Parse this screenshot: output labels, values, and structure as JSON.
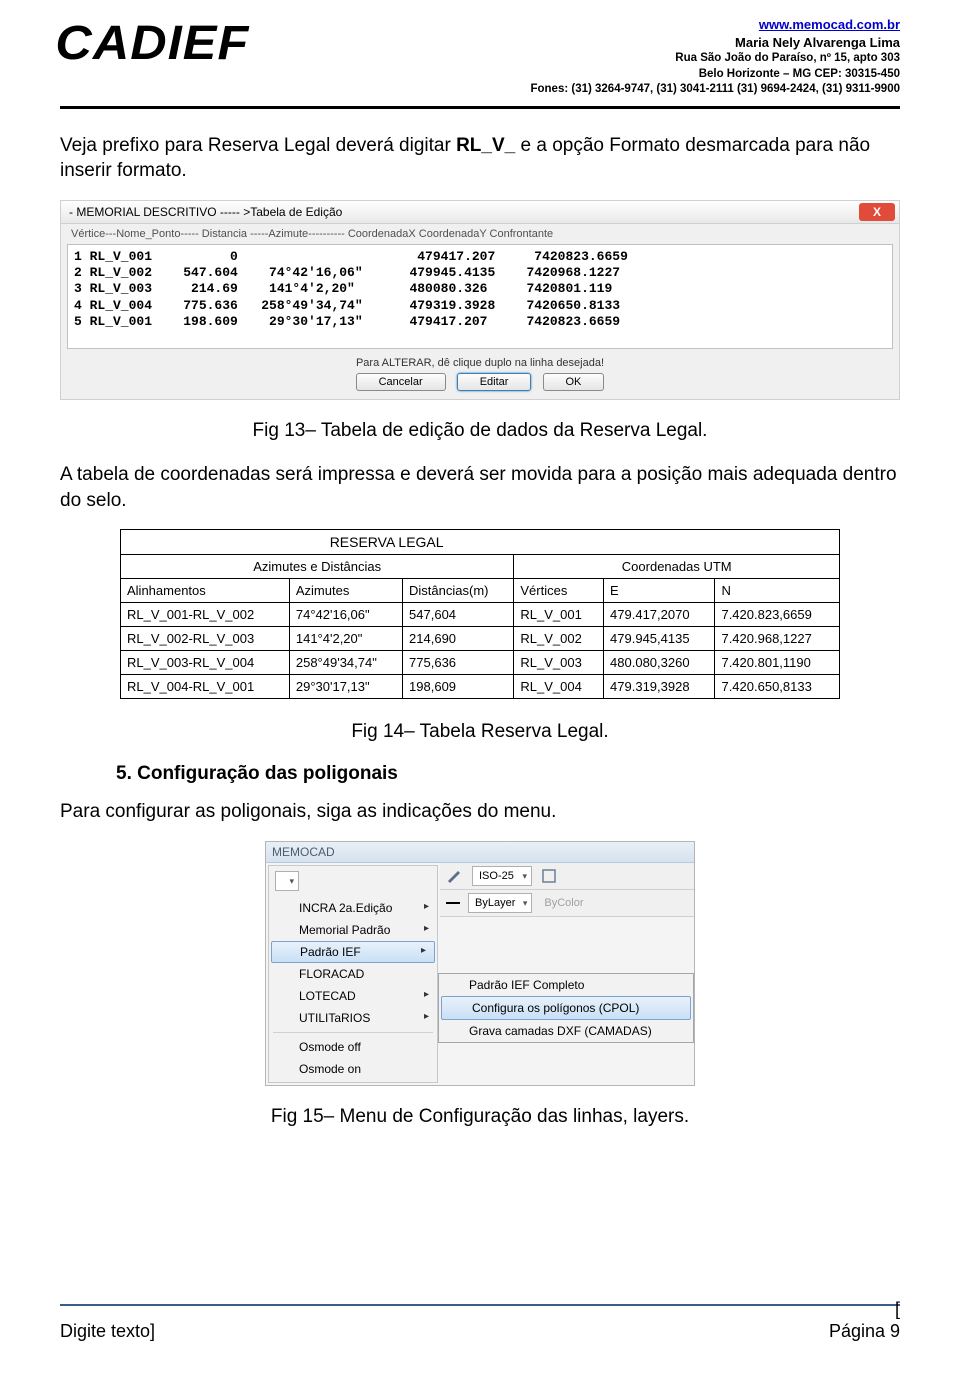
{
  "header": {
    "logo": "CADIEF",
    "url": "www.memocad.com.br",
    "name": "Maria Nely Alvarenga Lima",
    "addr1": "Rua São João do Paraíso, nº 15, apto 303",
    "addr2": "Belo Horizonte – MG CEP: 30315-450",
    "phones": "Fones: (31) 3264-9747, (31) 3041-2111  (31) 9694-2424, (31) 9311-9900"
  },
  "para1_a": "Veja prefixo para Reserva Legal deverá digitar  ",
  "para1_b": "RL_V_",
  "para1_c": "  e a opção Formato desmarcada para não inserir formato.",
  "dialog": {
    "title": "- MEMORIAL DESCRITIVO ----- >Tabela de Edição",
    "close": "X",
    "cols": "Vértice---Nome_Ponto-----  Distancia  -----Azimute----------              CoordenadaX  CoordenadaY   Confrontante",
    "rows": [
      "1 RL_V_001          0                       479417.207     7420823.6659",
      "2 RL_V_002    547.604    74°42'16,06\"      479945.4135    7420968.1227",
      "3 RL_V_003     214.69    141°4'2,20\"       480080.326     7420801.119",
      "4 RL_V_004    775.636   258°49'34,74\"      479319.3928    7420650.8133",
      "5 RL_V_001    198.609    29°30'17,13\"      479417.207     7420823.6659"
    ],
    "hint": "Para ALTERAR, dê clique duplo na linha desejada!",
    "btn_cancel": "Cancelar",
    "btn_edit": "Editar",
    "btn_ok": "OK"
  },
  "fig13": "Fig 13– Tabela de edição de dados da Reserva Legal.",
  "para2": "A tabela de coordenadas será impressa e deverá ser movida para a posição mais adequada dentro do selo.",
  "rl": {
    "title": "RESERVA LEGAL",
    "h1": "Azimutes e Distâncias",
    "h2": "Coordenadas UTM",
    "cols": [
      "Alinhamentos",
      "Azimutes",
      "Distâncias(m)",
      "Vértices",
      "E",
      "N"
    ],
    "rows": [
      [
        "RL_V_001-RL_V_002",
        "74°42'16,06\"",
        "547,604",
        "RL_V_001",
        "479.417,2070",
        "7.420.823,6659"
      ],
      [
        "RL_V_002-RL_V_003",
        "141°4'2,20\"",
        "214,690",
        "RL_V_002",
        "479.945,4135",
        "7.420.968,1227"
      ],
      [
        "RL_V_003-RL_V_004",
        "258°49'34,74\"",
        "775,636",
        "RL_V_003",
        "480.080,3260",
        "7.420.801,1190"
      ],
      [
        "RL_V_004-RL_V_001",
        "29°30'17,13\"",
        "198,609",
        "RL_V_004",
        "479.319,3928",
        "7.420.650,8133"
      ]
    ]
  },
  "fig14": "Fig 14– Tabela Reserva Legal.",
  "heading5": "5.  Configuração das poligonais",
  "para3": "Para configurar as poligonais, siga as indicações do menu.",
  "menu": {
    "app": "MEMOCAD",
    "tb_iso": "ISO-25",
    "tb_bylayer": "ByLayer",
    "tb_bycolor": "ByColor",
    "items": [
      "INCRA 2a.Edição",
      "Memorial Padrão",
      "Padrão IEF",
      "FLORACAD",
      "LOTECAD",
      "UTILITaRIOS",
      "Osmode off",
      "Osmode on"
    ],
    "sub": [
      "Padrão IEF Completo",
      "Configura os polígonos (CPOL)",
      "Grava camadas DXF (CAMADAS)"
    ]
  },
  "fig15": "Fig 15– Menu  de Configuração das linhas, layers.",
  "footer_left": "Digite texto]",
  "footer_right": "Página 9",
  "footer_bracket": "["
}
